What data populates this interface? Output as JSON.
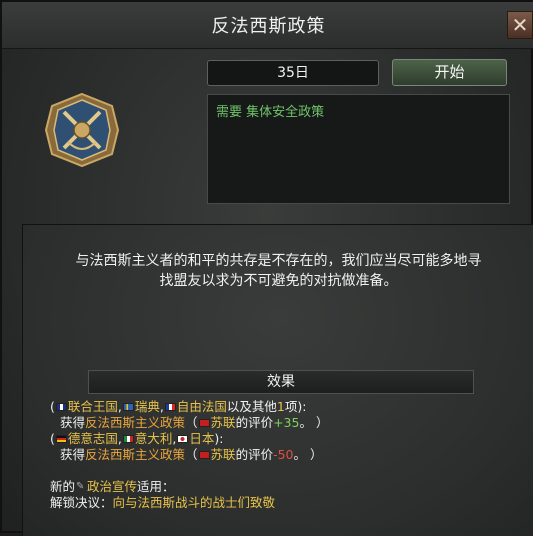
{
  "window": {
    "title": "反法西斯政策"
  },
  "controls": {
    "days": "35日",
    "start_label": "开始"
  },
  "requirement": "需要 集体安全政策",
  "description": {
    "line1": "与法西斯主义者的和平的共存是不存在的，我们应当尽可能多地寻",
    "line2": "找盟友以求为不可避免的对抗做准备。"
  },
  "effects": {
    "header": "效果",
    "group1": {
      "open": "(",
      "c1": "联合王国",
      "sep1": ",",
      "c2": "瑞典",
      "sep2": ",",
      "c3": "自由法国",
      "tail_a": "以及其他",
      "count": "1",
      "tail_b": "项):",
      "gain": "获得",
      "policy": "反法西斯主义政策",
      "paren_open": "（",
      "ussr": "苏联",
      "eval": "的评价",
      "value": "+35",
      "paren_close": "。 ）"
    },
    "group2": {
      "open": "(",
      "c1": "德意志国",
      "sep1": ",",
      "c2": "意大利",
      "sep2": ",",
      "c3": "日本",
      "tail": "):",
      "gain": "获得",
      "policy": "反法西斯主义政策",
      "paren_open": "（",
      "ussr": "苏联",
      "eval": "的评价",
      "value": "-50",
      "paren_close": "。 ）"
    },
    "propaganda": {
      "prefix": "新的",
      "name": "政治宣传",
      "suffix": "适用：",
      "unlock_label": "解锁决议：",
      "decision": "向与法西斯战斗的战士们致敬"
    }
  },
  "colors": {
    "requirement": "#6fc46a",
    "highlight": "#e7c24a",
    "positive": "#7dd25a",
    "negative": "#e0503c"
  },
  "icons": {
    "close": "close-icon",
    "emblem": "antifascist-emblem-icon",
    "propaganda": "megaphone-icon"
  }
}
